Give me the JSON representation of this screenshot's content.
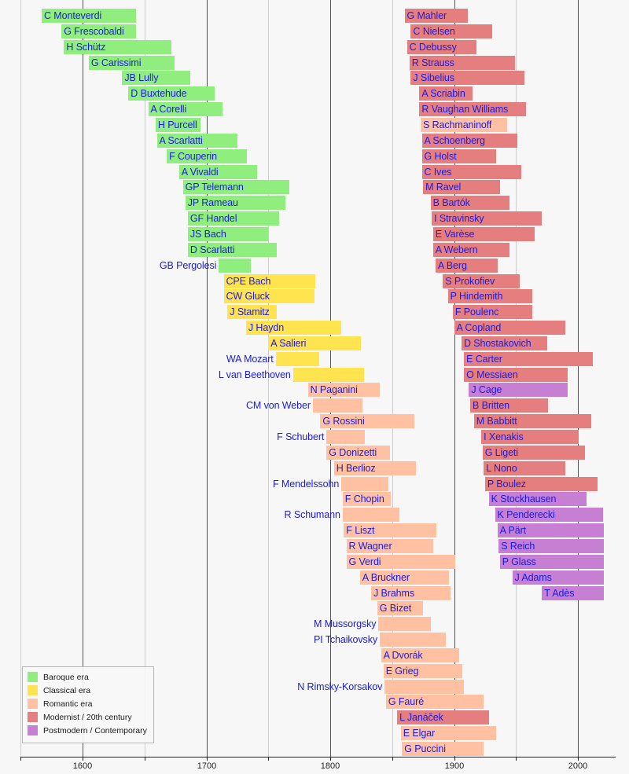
{
  "chart_data": {
    "type": "bar",
    "subtype": "gantt-timeline",
    "title": "",
    "xlabel": "",
    "ylabel": "",
    "xlim": [
      1560,
      2022
    ],
    "xticks": [
      1600,
      1700,
      1800,
      1900,
      2000
    ],
    "xtick_labels": [
      "1600",
      "1700",
      "1800",
      "1900",
      "2000"
    ],
    "minor_xticks": [
      1550,
      1650,
      1750,
      1850,
      1950,
      2000
    ],
    "grid": true,
    "legend_position": "bottom-left",
    "orientation": "horizontal",
    "note": "Each bar spans a composer's lifespan (birth year to death year); bar colour encodes musical era.",
    "series": [
      {
        "name": "Baroque era",
        "color": "#90ee7f",
        "values": [
          {
            "label": "C Monteverdi",
            "start": 1567,
            "end": 1643
          },
          {
            "label": "G Frescobaldi",
            "start": 1583,
            "end": 1643
          },
          {
            "label": "H Schütz",
            "start": 1585,
            "end": 1672
          },
          {
            "label": "G Carissimi",
            "start": 1605,
            "end": 1674
          },
          {
            "label": "JB Lully",
            "start": 1632,
            "end": 1687
          },
          {
            "label": "D Buxtehude",
            "start": 1637,
            "end": 1707
          },
          {
            "label": "A Corelli",
            "start": 1653,
            "end": 1713
          },
          {
            "label": "H Purcell",
            "start": 1659,
            "end": 1695
          },
          {
            "label": "A Scarlatti",
            "start": 1660,
            "end": 1725
          },
          {
            "label": "F Couperin",
            "start": 1668,
            "end": 1733
          },
          {
            "label": "A Vivaldi",
            "start": 1678,
            "end": 1741
          },
          {
            "label": "GP Telemann",
            "start": 1681,
            "end": 1767
          },
          {
            "label": "JP Rameau",
            "start": 1683,
            "end": 1764
          },
          {
            "label": "GF Handel",
            "start": 1685,
            "end": 1759
          },
          {
            "label": "JS Bach",
            "start": 1685,
            "end": 1750
          },
          {
            "label": "D Scarlatti",
            "start": 1685,
            "end": 1757
          },
          {
            "label": "GB Pergolesi",
            "start": 1710,
            "end": 1736
          }
        ]
      },
      {
        "name": "Classical era",
        "color": "#ffe34f",
        "values": [
          {
            "label": "CPE Bach",
            "start": 1714,
            "end": 1788
          },
          {
            "label": "CW Gluck",
            "start": 1714,
            "end": 1787
          },
          {
            "label": "J Stamitz",
            "start": 1717,
            "end": 1757
          },
          {
            "label": "J Haydn",
            "start": 1732,
            "end": 1809
          },
          {
            "label": "A Salieri",
            "start": 1750,
            "end": 1825
          },
          {
            "label": "WA Mozart",
            "start": 1756,
            "end": 1791
          },
          {
            "label": "L van Beethoven",
            "start": 1770,
            "end": 1827
          }
        ]
      },
      {
        "name": "Romantic era",
        "color": "#ffc1a2",
        "values": [
          {
            "label": "N Paganini",
            "start": 1782,
            "end": 1840
          },
          {
            "label": "CM von Weber",
            "start": 1786,
            "end": 1826
          },
          {
            "label": "G Rossini",
            "start": 1792,
            "end": 1868
          },
          {
            "label": "F Schubert",
            "start": 1797,
            "end": 1828
          },
          {
            "label": "G Donizetti",
            "start": 1797,
            "end": 1848
          },
          {
            "label": "H Berlioz",
            "start": 1803,
            "end": 1869
          },
          {
            "label": "F Mendelssohn",
            "start": 1809,
            "end": 1847
          },
          {
            "label": "F Chopin",
            "start": 1810,
            "end": 1849
          },
          {
            "label": "R Schumann",
            "start": 1810,
            "end": 1856
          },
          {
            "label": "F Liszt",
            "start": 1811,
            "end": 1886
          },
          {
            "label": "R Wagner",
            "start": 1813,
            "end": 1883
          },
          {
            "label": "G Verdi",
            "start": 1813,
            "end": 1901
          },
          {
            "label": "A Bruckner",
            "start": 1824,
            "end": 1896
          },
          {
            "label": "J Brahms",
            "start": 1833,
            "end": 1897
          },
          {
            "label": "G Bizet",
            "start": 1838,
            "end": 1875
          },
          {
            "label": "M Mussorgsky",
            "start": 1839,
            "end": 1881
          },
          {
            "label": "PI Tchaikovsky",
            "start": 1840,
            "end": 1893
          },
          {
            "label": "A Dvorák",
            "start": 1841,
            "end": 1904
          },
          {
            "label": "E Grieg",
            "start": 1843,
            "end": 1907
          },
          {
            "label": "N Rimsky-Korsakov",
            "start": 1844,
            "end": 1908
          },
          {
            "label": "G Fauré",
            "start": 1845,
            "end": 1924
          },
          {
            "label": "E Elgar",
            "start": 1857,
            "end": 1934
          },
          {
            "label": "G Puccini",
            "start": 1858,
            "end": 1924
          },
          {
            "label": "S Rachmaninoff",
            "start": 1873,
            "end": 1943
          }
        ]
      },
      {
        "name": "Modernist / 20th century",
        "color": "#e57f7f",
        "values": [
          {
            "label": "L Janáček",
            "start": 1854,
            "end": 1928
          },
          {
            "label": "G Mahler",
            "start": 1860,
            "end": 1911
          },
          {
            "label": "C Nielsen",
            "start": 1865,
            "end": 1931
          },
          {
            "label": "C Debussy",
            "start": 1862,
            "end": 1918
          },
          {
            "label": "R Strauss",
            "start": 1864,
            "end": 1949
          },
          {
            "label": "J Sibelius",
            "start": 1865,
            "end": 1957
          },
          {
            "label": "A Scriabin",
            "start": 1872,
            "end": 1915
          },
          {
            "label": "R Vaughan Williams",
            "start": 1872,
            "end": 1958
          },
          {
            "label": "A Schoenberg",
            "start": 1874,
            "end": 1951
          },
          {
            "label": "G Holst",
            "start": 1874,
            "end": 1934
          },
          {
            "label": "C Ives",
            "start": 1874,
            "end": 1954
          },
          {
            "label": "M Ravel",
            "start": 1875,
            "end": 1937
          },
          {
            "label": "B Bartók",
            "start": 1881,
            "end": 1945
          },
          {
            "label": "I Stravinsky",
            "start": 1882,
            "end": 1971
          },
          {
            "label": "E Varèse",
            "start": 1883,
            "end": 1965
          },
          {
            "label": "A Webern",
            "start": 1883,
            "end": 1945
          },
          {
            "label": "A Berg",
            "start": 1885,
            "end": 1935
          },
          {
            "label": "S Prokofiev",
            "start": 1891,
            "end": 1953
          },
          {
            "label": "P Hindemith",
            "start": 1895,
            "end": 1963
          },
          {
            "label": "F Poulenc",
            "start": 1899,
            "end": 1963
          },
          {
            "label": "A Copland",
            "start": 1900,
            "end": 1990
          },
          {
            "label": "D Shostakovich",
            "start": 1906,
            "end": 1975
          },
          {
            "label": "E Carter",
            "start": 1908,
            "end": 2012
          },
          {
            "label": "O Messiaen",
            "start": 1908,
            "end": 1992
          },
          {
            "label": "B Britten",
            "start": 1913,
            "end": 1976
          },
          {
            "label": "M Babbitt",
            "start": 1916,
            "end": 2011
          },
          {
            "label": "I Xenakis",
            "start": 1922,
            "end": 2001
          },
          {
            "label": "G Ligeti",
            "start": 1923,
            "end": 2006
          },
          {
            "label": "L Nono",
            "start": 1924,
            "end": 1990
          },
          {
            "label": "P Boulez",
            "start": 1925,
            "end": 2016
          }
        ]
      },
      {
        "name": "Postmodern / Contemporary",
        "color": "#c77fd4",
        "values": [
          {
            "label": "J Cage",
            "start": 1912,
            "end": 1992
          },
          {
            "label": "K Stockhausen",
            "start": 1928,
            "end": 2007
          },
          {
            "label": "K Penderecki",
            "start": 1933,
            "end": 2020
          },
          {
            "label": "A Pärt",
            "start": 1935,
            "end": 2021
          },
          {
            "label": "S Reich",
            "start": 1936,
            "end": 2021
          },
          {
            "label": "P Glass",
            "start": 1937,
            "end": 2021
          },
          {
            "label": "J Adams",
            "start": 1947,
            "end": 2021
          },
          {
            "label": "T Adès",
            "start": 1971,
            "end": 2021
          }
        ]
      }
    ]
  },
  "legend": {
    "items": [
      {
        "label": "Baroque era",
        "color": "#90ee7f"
      },
      {
        "label": "Classical era",
        "color": "#ffe34f"
      },
      {
        "label": "Romantic era",
        "color": "#ffc1a2"
      },
      {
        "label": "Modernist / 20th century",
        "color": "#e57f7f"
      },
      {
        "label": "Postmodern / Contemporary",
        "color": "#c77fd4"
      }
    ]
  },
  "axis": {
    "ticks": [
      {
        "value": 1600,
        "label": "1600"
      },
      {
        "value": 1700,
        "label": "1700"
      },
      {
        "value": 1800,
        "label": "1800"
      },
      {
        "value": 1900,
        "label": "1900"
      },
      {
        "value": 2000,
        "label": "2000"
      }
    ],
    "minor_ticks": [
      1550,
      1650,
      1750,
      1850,
      1950
    ]
  },
  "layout": {
    "left_column": [
      "C Monteverdi",
      "G Frescobaldi",
      "H Schütz",
      "G Carissimi",
      "JB Lully",
      "D Buxtehude",
      "A Corelli",
      "H Purcell",
      "A Scarlatti",
      "F Couperin",
      "A Vivaldi",
      "GP Telemann",
      "JP Rameau",
      "GF Handel",
      "JS Bach",
      "D Scarlatti",
      "GB Pergolesi",
      "CPE Bach",
      "CW Gluck",
      "J Stamitz",
      "J Haydn",
      "A Salieri",
      "WA Mozart",
      "L van Beethoven",
      "N Paganini",
      "CM von Weber",
      "G Rossini",
      "F Schubert",
      "G Donizetti",
      "H Berlioz",
      "F Mendelssohn",
      "F Chopin",
      "R Schumann",
      "F Liszt",
      "R Wagner",
      "G Verdi",
      "A Bruckner",
      "J Brahms",
      "G Bizet",
      "M Mussorgsky",
      "PI Tchaikovsky",
      "A Dvorák",
      "E Grieg",
      "N Rimsky-Korsakov",
      "G Fauré",
      "L Janáček",
      "E Elgar",
      "G Puccini"
    ],
    "right_column": [
      "G Mahler",
      "C Nielsen",
      "C Debussy",
      "R Strauss",
      "J Sibelius",
      "A Scriabin",
      "R Vaughan Williams",
      "S Rachmaninoff",
      "A Schoenberg",
      "G Holst",
      "C Ives",
      "M Ravel",
      "B Bartók",
      "I Stravinsky",
      "E Varèse",
      "A Webern",
      "A Berg",
      "S Prokofiev",
      "P Hindemith",
      "F Poulenc",
      "A Copland",
      "D Shostakovich",
      "E Carter",
      "O Messiaen",
      "J Cage",
      "B Britten",
      "M Babbitt",
      "I Xenakis",
      "G Ligeti",
      "L Nono",
      "P Boulez",
      "K Stockhausen",
      "K Penderecki",
      "A Pärt",
      "S Reich",
      "P Glass",
      "J Adams",
      "T Adès"
    ]
  }
}
